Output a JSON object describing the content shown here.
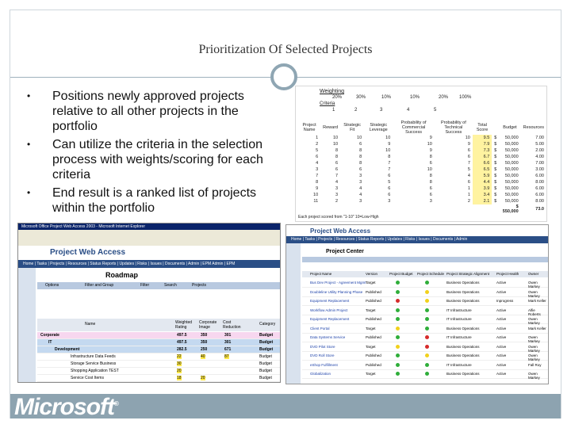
{
  "slide": {
    "title": "Prioritization Of Selected Projects",
    "bullets": [
      "Positions newly approved projects relative to all other projects in the portfolio",
      "Can utilize the criteria in the selection process with weights/scoring for each criteria",
      "End result is a ranked list of projects within the portfolio"
    ],
    "bullet_glyph": "•"
  },
  "criteria_shot": {
    "weighting_label": "Weighting",
    "weights": [
      "20%",
      "30%",
      "10%",
      "10%",
      "20%",
      "100%"
    ],
    "criteria_label": "Criteria",
    "criteria_nums": [
      "1",
      "2",
      "3",
      "4",
      "5"
    ],
    "headers": [
      "Project Name",
      "Reward",
      "Strategic Fit",
      "Strategic Leverage",
      "Probability of Commercial Success",
      "Probability of Technical Success",
      "Total Score",
      "Budget",
      "Resources"
    ],
    "rows": [
      [
        "1",
        "10",
        "10",
        "10",
        "9",
        "10",
        "9.5",
        "$",
        "50,000",
        "7.00"
      ],
      [
        "2",
        "10",
        "6",
        "9",
        "10",
        "9",
        "7.9",
        "$",
        "50,000",
        "5.00"
      ],
      [
        "5",
        "8",
        "8",
        "10",
        "9",
        "6",
        "7.3",
        "$",
        "50,000",
        "2.00"
      ],
      [
        "6",
        "8",
        "8",
        "8",
        "8",
        "6",
        "6.7",
        "$",
        "50,000",
        "4.00"
      ],
      [
        "4",
        "6",
        "8",
        "7",
        "6",
        "7",
        "6.6",
        "$",
        "50,000",
        "7.00"
      ],
      [
        "3",
        "6",
        "6",
        "7",
        "10",
        "5",
        "6.5",
        "$",
        "50,000",
        "3.00"
      ],
      [
        "7",
        "7",
        "3",
        "6",
        "8",
        "4",
        "5.9",
        "$",
        "50,000",
        "6.00"
      ],
      [
        "8",
        "4",
        "3",
        "5",
        "8",
        "6",
        "4.4",
        "$",
        "50,000",
        "8.00"
      ],
      [
        "9",
        "3",
        "4",
        "6",
        "6",
        "1",
        "3.9",
        "$",
        "50,000",
        "6.00"
      ],
      [
        "10",
        "3",
        "4",
        "6",
        "6",
        "1",
        "3.4",
        "$",
        "50,000",
        "6.00"
      ],
      [
        "11",
        "2",
        "3",
        "3",
        "3",
        "2",
        "2.1",
        "$",
        "50,000",
        "8.00"
      ]
    ],
    "total_budget": "$ 550,000",
    "total_resources": "73.0",
    "note": "Each project scored from \"1-10\" 10=Low-High"
  },
  "roadmap_shot": {
    "window_title": "Microsoft Office Project Web Access 2003 - Microsoft Internet Explorer",
    "product": "Project Web Access",
    "nav": "Home | Tasks | Projects | Resources | Status Reports | Updates | Risks | Issues | Documents | Admin | EPM Admin | EPM",
    "page_title": "Roadmap",
    "toolbar": [
      "Options",
      "Filter and Group",
      "Filter",
      "Search",
      "Projects"
    ],
    "columns": [
      "Name",
      "Weighted Rating",
      "Corporate Image",
      "Cost Reduction",
      "Category"
    ],
    "rows": [
      {
        "name": "Corporate",
        "rating": "497.5",
        "image": "350",
        "cost": "301",
        "cat": "Budget"
      },
      {
        "name": "IT",
        "rating": "497.5",
        "image": "350",
        "cost": "301",
        "cat": "Budget"
      },
      {
        "name": "Development",
        "rating": "282.5",
        "image": "250",
        "cost": "671",
        "cat": "Budget"
      },
      {
        "name": "Infrastructure Data Feeds",
        "rating": "22",
        "image": "40",
        "cost": "87",
        "cat": "Budget"
      },
      {
        "name": "Storage Service Business",
        "rating": "30",
        "image": "",
        "cost": "",
        "cat": "Budget"
      },
      {
        "name": "Shopping Application TEST",
        "rating": "20",
        "image": "",
        "cost": "",
        "cat": "Budget"
      },
      {
        "name": "Service Cost Items",
        "rating": "18",
        "image": "20",
        "cost": "",
        "cat": "Budget"
      }
    ]
  },
  "projcenter_shot": {
    "product": "Project Web Access",
    "nav": "Home | Tasks | Projects | Resources | Status Reports | Updates | Risks | Issues | Documents | Admin",
    "page_title": "Project Center",
    "columns": [
      "Project Name",
      "Version",
      "Project Budget",
      "Project Schedule",
      "Project Strategic Alignment",
      "Project Health",
      "Owner"
    ],
    "rows": [
      {
        "name": "Bus Dev Project - Agreement Mgmt",
        "version": "Target",
        "budget": "green",
        "sched": "green",
        "align": "Business Operations",
        "health": "Active",
        "owner": "Owen Markey"
      },
      {
        "name": "Doubleline Utility Planning Phase",
        "version": "Published",
        "budget": "green",
        "sched": "yellow",
        "align": "Business Operations",
        "health": "Active",
        "owner": "Owen Markey"
      },
      {
        "name": "Equipment Replacement",
        "version": "Published",
        "budget": "red",
        "sched": "yellow",
        "align": "Business Operations",
        "health": "Inprogress",
        "owner": "Mark Keller"
      },
      {
        "name": "Workflow Admin Project",
        "version": "Target",
        "budget": "green",
        "sched": "green",
        "align": "IT Infrastructure",
        "health": "Active",
        "owner": "Alfie Roberts"
      },
      {
        "name": "Equipment Replacement",
        "version": "Published",
        "budget": "green",
        "sched": "green",
        "align": "IT Infrastructure",
        "health": "Active",
        "owner": "Owen Markey"
      },
      {
        "name": "Client Portal",
        "version": "Target",
        "budget": "yellow",
        "sched": "green",
        "align": "Business Operations",
        "health": "Active",
        "owner": "Mark Keller"
      },
      {
        "name": "Data Systems Service",
        "version": "Published",
        "budget": "green",
        "sched": "red",
        "align": "IT Infrastructure",
        "health": "Active",
        "owner": "Owen Markey"
      },
      {
        "name": "DVD Pilot Store",
        "version": "Target",
        "budget": "yellow",
        "sched": "red",
        "align": "Business Operations",
        "health": "Active",
        "owner": "Owen Markey"
      },
      {
        "name": "DVD Roll Store",
        "version": "Published",
        "budget": "green",
        "sched": "yellow",
        "align": "Business Operations",
        "health": "Active",
        "owner": "Owen Markey"
      },
      {
        "name": "eShop Fulfillment",
        "version": "Published",
        "budget": "green",
        "sched": "green",
        "align": "IT Infrastructure",
        "health": "Active",
        "owner": "Fall Roy"
      },
      {
        "name": "Globalization",
        "version": "Target",
        "budget": "green",
        "sched": "green",
        "align": "Business Operations",
        "health": "Active",
        "owner": "Owen Markey"
      }
    ]
  },
  "footer": {
    "logo_text": "Microsoft",
    "logo_mark": "®"
  },
  "colors": {
    "title": "#333333",
    "accent": "#8da3b0",
    "pwa_header": "#2a4e86",
    "highlight_yellow": "#fff3a0",
    "status_green": "#2fae3a",
    "status_yellow": "#f2d11c",
    "status_red": "#d62b2b"
  }
}
